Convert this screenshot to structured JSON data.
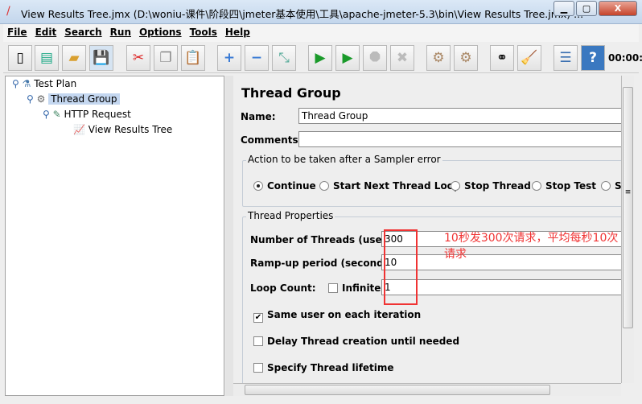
{
  "window": {
    "title": "View Results Tree.jmx (D:\\woniu-课件\\阶段四\\jmeter基本使用\\工具\\apache-jmeter-5.3\\bin\\View Results Tree.jmx) ...",
    "minimize": "▁",
    "maximize": "▢",
    "close": "X"
  },
  "menu": [
    "File",
    "Edit",
    "Search",
    "Run",
    "Options",
    "Tools",
    "Help"
  ],
  "toolbar": {
    "icons": [
      "new-icon",
      "templates-icon",
      "open-icon",
      "save-icon",
      "cut-icon",
      "copy-icon",
      "paste-icon",
      "expand-icon",
      "collapse-icon",
      "toggle-icon",
      "start-icon",
      "start-no-timers-icon",
      "stop-icon",
      "shutdown-icon",
      "clear-icon",
      "clear-all-icon",
      "search-icon",
      "reset-search-icon",
      "function-helper-icon",
      "help-icon"
    ],
    "timer": "00:00:"
  },
  "tree": [
    {
      "label": "Test Plan"
    },
    {
      "label": "Thread Group",
      "selected": true
    },
    {
      "label": "HTTP Request"
    },
    {
      "label": "View Results Tree"
    }
  ],
  "panel": {
    "title": "Thread Group",
    "name_label": "Name:",
    "name_value": "Thread Group",
    "comments_label": "Comments:",
    "comments_value": "",
    "error_group": "Action to be taken after a Sampler error",
    "error_options": [
      "Continue",
      "Start Next Thread Loop",
      "Stop Thread",
      "Stop Test",
      "S"
    ],
    "error_selected": "Continue",
    "props_group": "Thread Properties",
    "threads_label": "Number of Threads (users):",
    "threads_value": "300",
    "rampup_label": "Ramp-up period (seconds):",
    "rampup_value": "10",
    "loop_label": "Loop Count:",
    "infinite_label": "Infinite",
    "infinite_checked": false,
    "loop_value": "1",
    "same_user_label": "Same user on each iteration",
    "same_user_checked": true,
    "delay_label": "Delay Thread creation until needed",
    "delay_checked": false,
    "lifetime_label": "Specify Thread lifetime",
    "lifetime_checked": false
  },
  "annotation": {
    "text": "10秒发300次请求，平均每秒10次请求",
    "color": "#f03333"
  }
}
